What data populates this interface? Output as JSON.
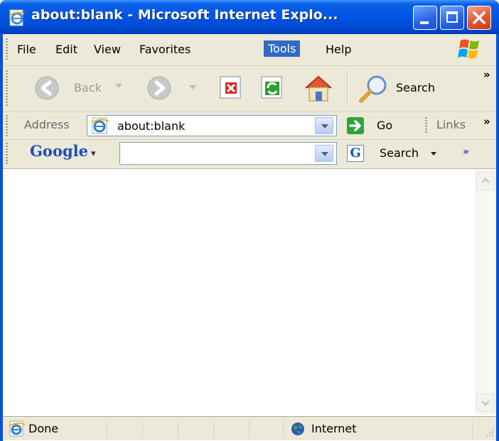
{
  "window": {
    "title": "about:blank - Microsoft Internet Explo...",
    "accent": "#0055e5"
  },
  "menu": {
    "items": [
      "File",
      "Edit",
      "View",
      "Favorites",
      "Tools",
      "Help"
    ],
    "active": "Tools"
  },
  "toolbar": {
    "back_label": "Back",
    "search_label": "Search",
    "overflow": "»"
  },
  "address": {
    "label": "Address",
    "value": "about:blank",
    "go_label": "Go",
    "links_label": "Links",
    "overflow": "»"
  },
  "google": {
    "logo": "Google",
    "logo_dropdown": "▾",
    "search_value": "",
    "search_label": "Search",
    "overflow": "»"
  },
  "status": {
    "text": "Done",
    "zone": "Internet"
  },
  "icons": [
    "ie-page-icon",
    "windows-logo-icon",
    "back-arrow-icon",
    "forward-arrow-icon",
    "stop-icon",
    "refresh-icon",
    "home-icon",
    "magnifier-icon",
    "go-arrow-icon",
    "globe-icon",
    "resize-grip-icon"
  ]
}
